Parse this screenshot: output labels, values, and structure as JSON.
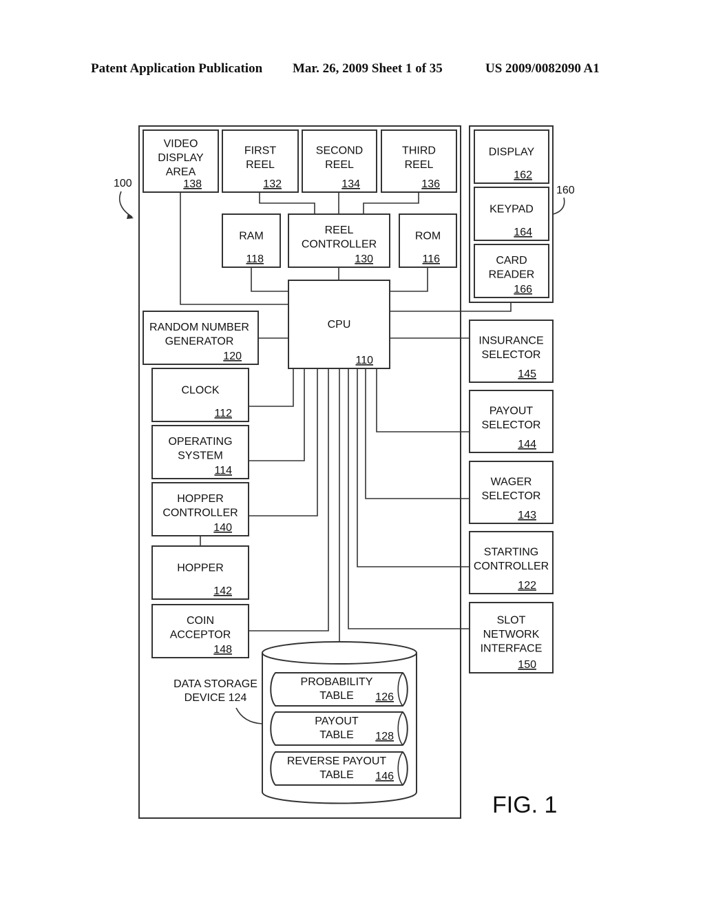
{
  "header": {
    "publication": "Patent Application Publication",
    "date_sheet": "Mar. 26, 2009  Sheet 1 of 35",
    "number": "US 2009/0082090 A1"
  },
  "figure_label": "FIG. 1",
  "refs": {
    "device": "100",
    "player_interface": "160",
    "storage_line1": "DATA STORAGE",
    "storage_line2": "DEVICE 124"
  },
  "blocks": {
    "video_display": {
      "lines": [
        "VIDEO",
        "DISPLAY",
        "AREA"
      ],
      "num": "138"
    },
    "first_reel": {
      "lines": [
        "FIRST",
        "REEL"
      ],
      "num": "132"
    },
    "second_reel": {
      "lines": [
        "SECOND",
        "REEL"
      ],
      "num": "134"
    },
    "third_reel": {
      "lines": [
        "THIRD",
        "REEL"
      ],
      "num": "136"
    },
    "ram": {
      "lines": [
        "RAM"
      ],
      "num": "118"
    },
    "reel_controller": {
      "lines": [
        "REEL",
        "CONTROLLER"
      ],
      "num": "130"
    },
    "rom": {
      "lines": [
        "ROM"
      ],
      "num": "116"
    },
    "cpu": {
      "lines": [
        "CPU"
      ],
      "num": "110"
    },
    "rng": {
      "lines": [
        "RANDOM NUMBER",
        "GENERATOR"
      ],
      "num": "120"
    },
    "clock": {
      "lines": [
        "CLOCK"
      ],
      "num": "112"
    },
    "os": {
      "lines": [
        "OPERATING",
        "SYSTEM"
      ],
      "num": "114"
    },
    "hopper_controller": {
      "lines": [
        "HOPPER",
        "CONTROLLER"
      ],
      "num": "140"
    },
    "hopper": {
      "lines": [
        "HOPPER"
      ],
      "num": "142"
    },
    "coin_acceptor": {
      "lines": [
        "COIN",
        "ACCEPTOR"
      ],
      "num": "148"
    },
    "display": {
      "lines": [
        "DISPLAY"
      ],
      "num": "162"
    },
    "keypad": {
      "lines": [
        "KEYPAD"
      ],
      "num": "164"
    },
    "card_reader": {
      "lines": [
        "CARD",
        "READER"
      ],
      "num": "166"
    },
    "insurance_selector": {
      "lines": [
        "INSURANCE",
        "SELECTOR"
      ],
      "num": "145"
    },
    "payout_selector": {
      "lines": [
        "PAYOUT",
        "SELECTOR"
      ],
      "num": "144"
    },
    "wager_selector": {
      "lines": [
        "WAGER",
        "SELECTOR"
      ],
      "num": "143"
    },
    "starting_controller": {
      "lines": [
        "STARTING",
        "CONTROLLER"
      ],
      "num": "122"
    },
    "slot_network": {
      "lines": [
        "SLOT",
        "NETWORK",
        "INTERFACE"
      ],
      "num": "150"
    }
  },
  "tables": {
    "probability": {
      "lines": [
        "PROBABILITY",
        "TABLE"
      ],
      "num": "126"
    },
    "payout": {
      "lines": [
        "PAYOUT",
        "TABLE"
      ],
      "num": "128"
    },
    "reverse_payout": {
      "lines": [
        "REVERSE PAYOUT",
        "TABLE"
      ],
      "num": "146"
    }
  }
}
